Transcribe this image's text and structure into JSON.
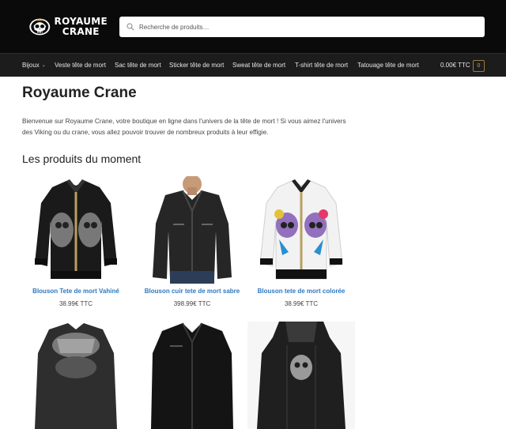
{
  "header": {
    "logo_line1": "ROYAUME",
    "logo_line2": "CRANE",
    "search_placeholder": "Recherche de produits…"
  },
  "nav": {
    "items": [
      {
        "label": "Bijoux",
        "has_dropdown": true
      },
      {
        "label": "Veste tête de mort"
      },
      {
        "label": "Sac tête de mort"
      },
      {
        "label": "Sticker tête de mort"
      },
      {
        "label": "Sweat tête de mort"
      },
      {
        "label": "T-shirt tête de mort"
      },
      {
        "label": "Tatouage tête de mort"
      }
    ],
    "cart_total": "0.00€ TTC",
    "cart_count": "0"
  },
  "main": {
    "title": "Royaume Crane",
    "intro": "Bienvenue sur Royaume Crane, votre boutique en ligne dans l'univers de la tête de mort ! Si vous aimez l'univers des Viking ou du crane, vous allez pouvoir trouver de nombreux produits à leur effigie.",
    "section_title": "Les produits du moment",
    "products": [
      {
        "name": "Blouson Tete de mort Vahiné",
        "price": "38.99€ TTC"
      },
      {
        "name": "Blouson cuir tete de mort sabre",
        "price": "398.99€ TTC"
      },
      {
        "name": "Blouson tete de mort colorée",
        "price": "38.99€ TTC"
      },
      {
        "name": "",
        "price": ""
      },
      {
        "name": "",
        "price": ""
      },
      {
        "name": "",
        "price": ""
      }
    ]
  },
  "colors": {
    "header_bg": "#0a0a0a",
    "nav_bg": "#1c1c1c",
    "link": "#2d78c2",
    "cart_accent": "#c9a450"
  }
}
